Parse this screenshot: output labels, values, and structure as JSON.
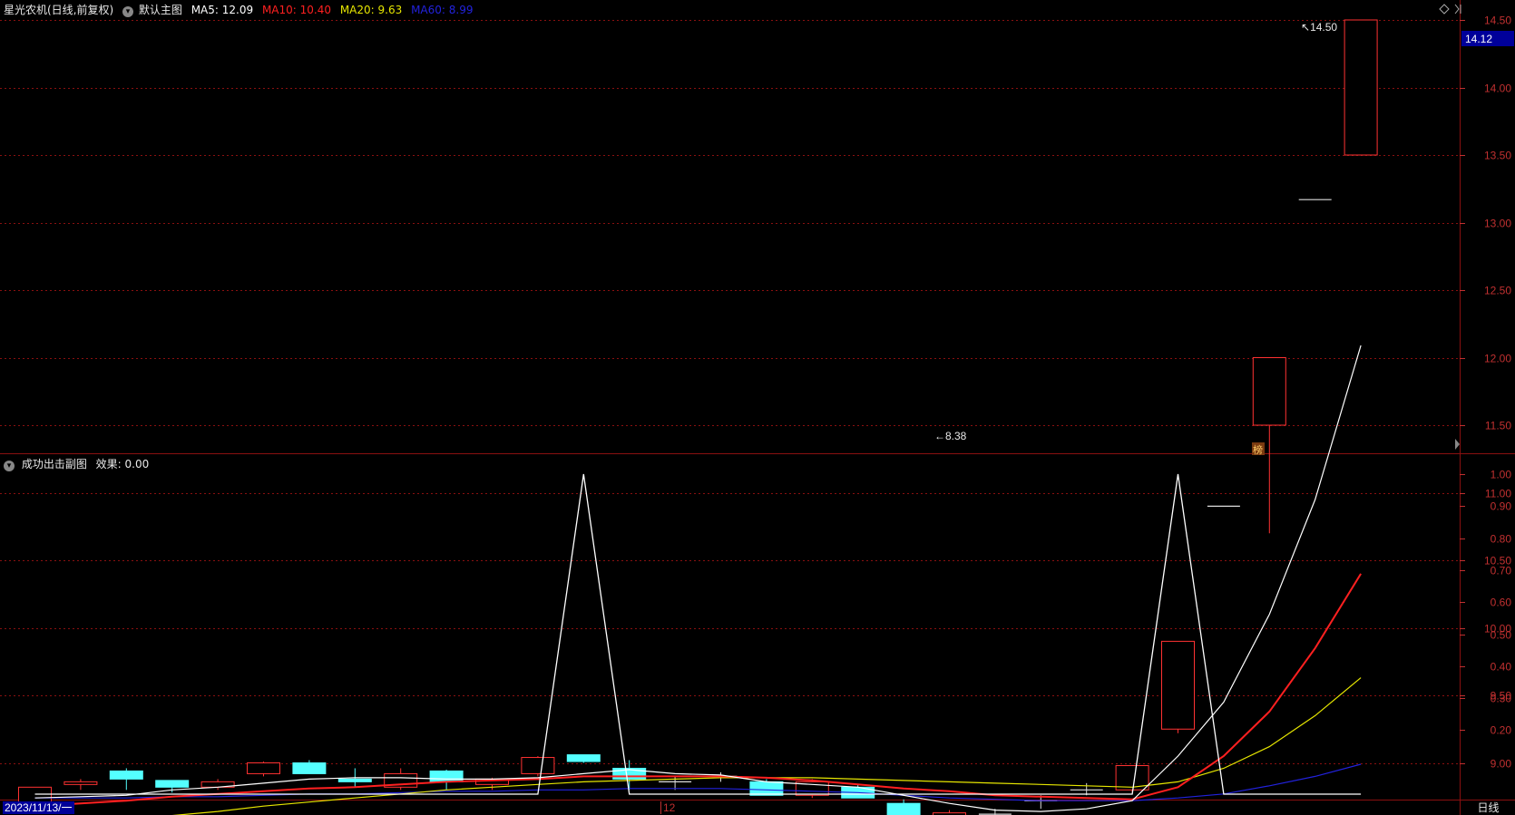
{
  "header": {
    "stock_title": "星光农机(日线,前复权)",
    "main_chart_name": "默认主图",
    "ma5": "MA5: 12.09",
    "ma10": "MA10: 10.40",
    "ma20": "MA20: 9.63",
    "ma60": "MA60: 8.99"
  },
  "sub_header": {
    "indicator_name": "成功出击副图",
    "effect": "效果: 0.00"
  },
  "footer": {
    "start_date": "2023/11/13/一",
    "month_mark": "12",
    "period_button": "日线"
  },
  "price_marks": {
    "last_price": "14.12",
    "high_label": "14.50",
    "low_label": "8.38",
    "badge": "榜"
  },
  "colors": {
    "up": "#ff3232",
    "down": "#54ffff",
    "ma5": "#ffffff",
    "ma10": "#ff2020",
    "ma20": "#e6e600",
    "ma60": "#2222dd",
    "grid": "#8a1010",
    "axis_text": "#c03030"
  },
  "chart_data": [
    {
      "type": "candlestick",
      "y_ticks": [
        "14.50",
        "14.00",
        "13.50",
        "13.00",
        "12.50",
        "12.00",
        "11.50",
        "11.00",
        "10.50",
        "10.00",
        "9.50",
        "9.00",
        "8.50"
      ],
      "ylim": [
        8.15,
        14.75
      ],
      "candles": [
        {
          "o": 8.7,
          "c": 8.82,
          "h": 8.82,
          "l": 8.66
        },
        {
          "o": 8.84,
          "c": 8.86,
          "h": 8.88,
          "l": 8.8
        },
        {
          "o": 8.94,
          "c": 8.88,
          "h": 8.96,
          "l": 8.8
        },
        {
          "o": 8.87,
          "c": 8.82,
          "h": 8.87,
          "l": 8.78
        },
        {
          "o": 8.82,
          "c": 8.86,
          "h": 8.88,
          "l": 8.8
        },
        {
          "o": 8.92,
          "c": 9.0,
          "h": 9.01,
          "l": 8.9
        },
        {
          "o": 9.0,
          "c": 8.92,
          "h": 9.02,
          "l": 8.92
        },
        {
          "o": 8.88,
          "c": 8.86,
          "h": 8.96,
          "l": 8.82
        },
        {
          "o": 8.82,
          "c": 8.92,
          "h": 8.96,
          "l": 8.8
        },
        {
          "o": 8.94,
          "c": 8.86,
          "h": 8.95,
          "l": 8.8
        },
        {
          "o": 8.84,
          "c": 8.88,
          "h": 8.89,
          "l": 8.8
        },
        {
          "o": 8.92,
          "c": 9.04,
          "h": 9.05,
          "l": 8.9
        },
        {
          "o": 9.06,
          "c": 9.01,
          "h": 9.06,
          "l": 9.0
        },
        {
          "o": 8.96,
          "c": 8.88,
          "h": 9.02,
          "l": 8.8
        },
        {
          "o": 8.86,
          "c": 8.86,
          "h": 8.9,
          "l": 8.8
        },
        {
          "o": 8.9,
          "c": 8.9,
          "h": 8.93,
          "l": 8.86
        },
        {
          "o": 8.86,
          "c": 8.76,
          "h": 8.88,
          "l": 8.76
        },
        {
          "o": 8.76,
          "c": 8.86,
          "h": 8.88,
          "l": 8.74
        },
        {
          "o": 8.82,
          "c": 8.74,
          "h": 8.84,
          "l": 8.74
        },
        {
          "o": 8.7,
          "c": 8.52,
          "h": 8.73,
          "l": 8.52
        },
        {
          "o": 8.52,
          "c": 8.63,
          "h": 8.65,
          "l": 8.38
        },
        {
          "o": 8.62,
          "c": 8.62,
          "h": 8.66,
          "l": 8.54
        },
        {
          "o": 8.72,
          "c": 8.72,
          "h": 8.76,
          "l": 8.66
        },
        {
          "o": 8.8,
          "c": 8.8,
          "h": 8.85,
          "l": 8.76
        },
        {
          "o": 8.8,
          "c": 8.98,
          "h": 8.98,
          "l": 8.78
        },
        {
          "o": 9.25,
          "c": 9.9,
          "h": 9.9,
          "l": 9.22
        },
        {
          "o": 10.9,
          "c": 10.9,
          "h": 10.9,
          "l": 10.9
        },
        {
          "o": 11.5,
          "c": 12.0,
          "h": 12.0,
          "l": 10.7
        },
        {
          "o": 13.17,
          "c": 13.17,
          "h": 13.17,
          "l": 13.17
        },
        {
          "o": 13.5,
          "c": 14.5,
          "h": 14.5,
          "l": 13.5
        }
      ],
      "ma5": [
        8.74,
        8.75,
        8.76,
        8.8,
        8.82,
        8.85,
        8.88,
        8.89,
        8.89,
        8.88,
        8.88,
        8.89,
        8.92,
        8.95,
        8.92,
        8.91,
        8.86,
        8.84,
        8.82,
        8.76,
        8.7,
        8.65,
        8.64,
        8.66,
        8.72,
        9.05,
        9.45,
        10.1,
        10.95,
        12.09
      ],
      "ma10": [
        8.68,
        8.7,
        8.72,
        8.75,
        8.77,
        8.79,
        8.81,
        8.82,
        8.84,
        8.86,
        8.87,
        8.88,
        8.9,
        8.9,
        8.9,
        8.9,
        8.89,
        8.87,
        8.84,
        8.81,
        8.79,
        8.76,
        8.75,
        8.74,
        8.73,
        8.82,
        9.05,
        9.38,
        9.85,
        10.4
      ],
      "ma20": [
        8.5,
        8.53,
        8.57,
        8.61,
        8.64,
        8.68,
        8.71,
        8.74,
        8.77,
        8.8,
        8.82,
        8.84,
        8.86,
        8.87,
        8.88,
        8.89,
        8.89,
        8.89,
        8.88,
        8.87,
        8.86,
        8.85,
        8.84,
        8.83,
        8.82,
        8.86,
        8.96,
        9.12,
        9.35,
        9.63
      ],
      "ma60": [
        8.74,
        8.74,
        8.74,
        8.75,
        8.75,
        8.76,
        8.77,
        8.77,
        8.78,
        8.79,
        8.79,
        8.8,
        8.8,
        8.81,
        8.81,
        8.81,
        8.8,
        8.79,
        8.78,
        8.76,
        8.74,
        8.73,
        8.72,
        8.72,
        8.72,
        8.74,
        8.77,
        8.83,
        8.9,
        8.99
      ]
    },
    {
      "type": "line",
      "y_ticks": [
        "1.00",
        "0.90",
        "0.80",
        "0.70",
        "0.60",
        "0.50",
        "0.40",
        "0.30",
        "0.20"
      ],
      "ylim": [
        0,
        1
      ],
      "x": [
        0,
        11,
        12,
        13,
        24,
        25,
        26,
        29
      ],
      "values": [
        0,
        0,
        1,
        0,
        0,
        1,
        0,
        0
      ]
    }
  ]
}
